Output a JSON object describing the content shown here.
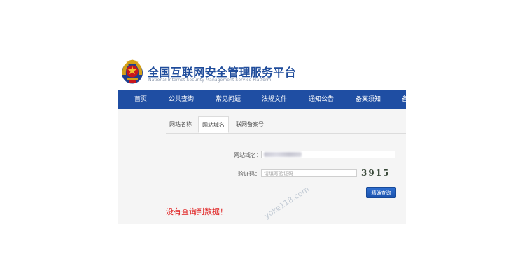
{
  "header": {
    "title": "全国互联网安全管理服务平台",
    "subtitle": "National Internet Security Management Service Platform"
  },
  "nav": {
    "items": [
      {
        "label": "首页"
      },
      {
        "label": "公共查询"
      },
      {
        "label": "常见问题"
      },
      {
        "label": "法规文件"
      },
      {
        "label": "通知公告"
      },
      {
        "label": "备案须知"
      },
      {
        "label": "备"
      }
    ]
  },
  "tabs": [
    {
      "label": "网站名称",
      "active": false
    },
    {
      "label": "网站域名",
      "active": true
    },
    {
      "label": "联网备案号",
      "active": false
    }
  ],
  "form": {
    "domain_label": "网站域名：",
    "captcha_label": "验证码：",
    "captcha_placeholder": "请填写验证码",
    "captcha_code": "3915",
    "submit_label": "精确查询"
  },
  "result": {
    "message": "没有查询到数据！"
  },
  "watermark": "yoke118.com",
  "colors": {
    "nav_bg": "#1f4ea3",
    "brand_text": "#1f4c9b",
    "error_text": "#e02020",
    "button_bg": "#1b52ad"
  }
}
